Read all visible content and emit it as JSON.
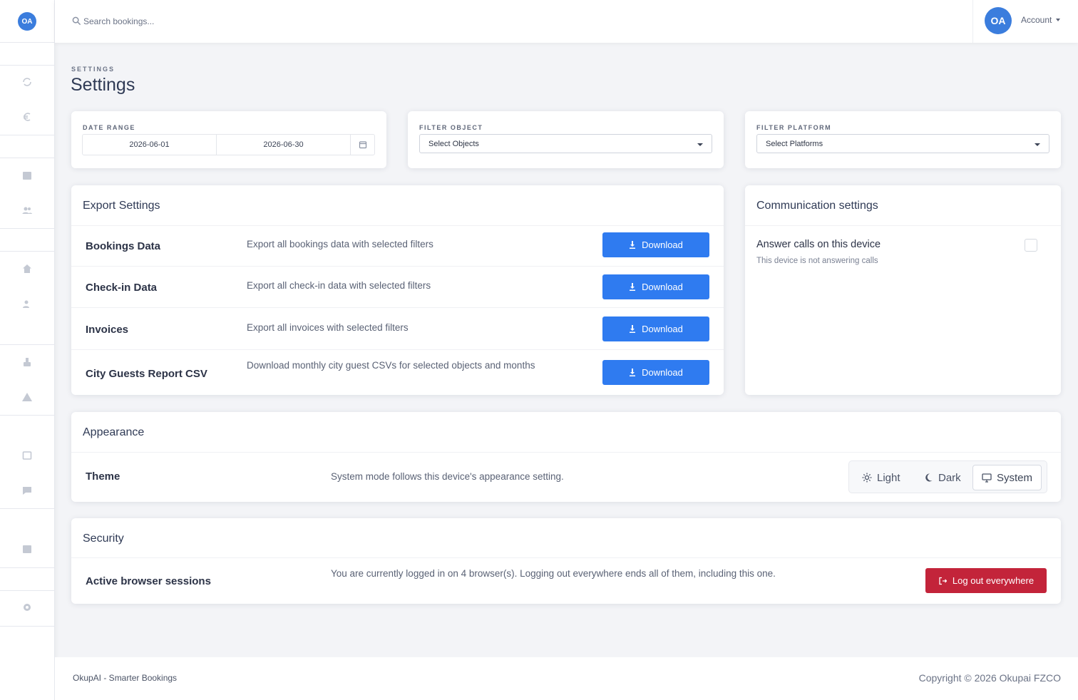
{
  "app": {
    "logo_text": "OA"
  },
  "search": {
    "placeholder": "Search bookings..."
  },
  "account": {
    "avatar_initials": "OA",
    "label": "Account"
  },
  "page": {
    "pre_title": "SETTINGS",
    "title": "Settings"
  },
  "filters": {
    "date_range": {
      "label": "DATE RANGE",
      "start": "2026-06-01",
      "end": "2026-06-30"
    },
    "object": {
      "label": "FILTER OBJECT",
      "value": "Select Objects"
    },
    "platform": {
      "label": "FILTER PLATFORM",
      "value": "Select Platforms"
    }
  },
  "export": {
    "title": "Export Settings",
    "rows": [
      {
        "label": "Bookings Data",
        "description": "Export all bookings data with selected filters",
        "button": "Download"
      },
      {
        "label": "Check-in Data",
        "description": "Export all check-in data with selected filters",
        "button": "Download"
      },
      {
        "label": "Invoices",
        "description": "Export all invoices with selected filters",
        "button": "Download"
      },
      {
        "label": "City Guests Report CSV",
        "description": "Download monthly city guest CSVs for selected objects and months",
        "button": "Download"
      }
    ]
  },
  "communication": {
    "title": "Communication settings",
    "answer_calls_label": "Answer calls on this device",
    "answer_calls_status": "This device is not answering calls",
    "answer_calls_checked": false
  },
  "appearance": {
    "title": "Appearance",
    "theme_label": "Theme",
    "theme_description": "System mode follows this device's appearance setting.",
    "options": [
      "Light",
      "Dark",
      "System"
    ],
    "selected": "System"
  },
  "security": {
    "title": "Security",
    "sessions_label": "Active browser sessions",
    "sessions_description": "You are currently logged in on 4 browser(s). Logging out everywhere ends all of them, including this one.",
    "logout_button": "Log out everywhere"
  },
  "footer": {
    "left": "OkupAI - Smarter Bookings",
    "right": "Copyright © 2026 Okupai FZCO"
  },
  "colors": {
    "primary": "#2f7bf0",
    "danger": "#c3243a",
    "brand": "#3b7ddd"
  }
}
